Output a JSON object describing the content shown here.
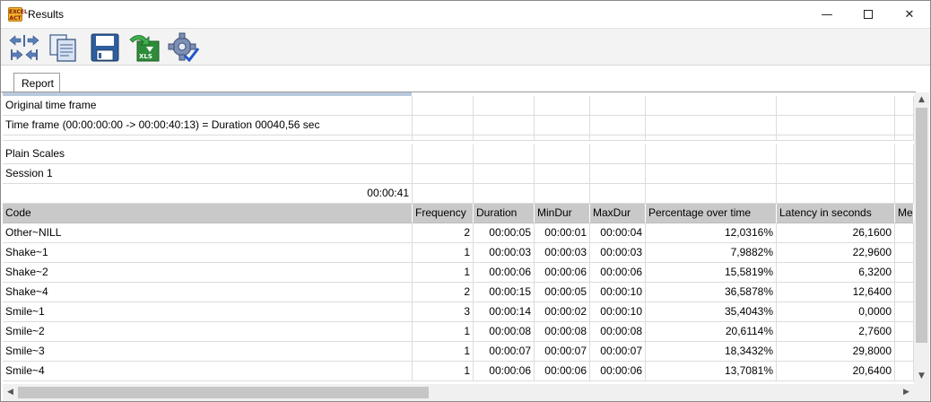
{
  "window": {
    "title": "Results",
    "app_icon_text": "EXCEL ACT",
    "controls": {
      "minimize": "—",
      "close": "✕"
    }
  },
  "toolbar": {
    "buttons": [
      {
        "icon": "arrows-expand-collapse-icon"
      },
      {
        "icon": "copy-document-icon"
      },
      {
        "icon": "save-disk-icon"
      },
      {
        "icon": "export-xls-icon",
        "label": "XLS"
      },
      {
        "icon": "settings-gear-check-icon"
      }
    ]
  },
  "tabs": [
    {
      "label": "Report"
    }
  ],
  "report": {
    "info_rows": [
      "Original time frame",
      "Time frame  (00:00:00:00 -> 00:00:40:13) = Duration 00040,56 sec",
      "",
      "Plain Scales",
      "Session 1"
    ],
    "total_time": "00:00:41",
    "columns": [
      "Code",
      "Frequency",
      "Duration",
      "MinDur",
      "MaxDur",
      "Percentage over time",
      "Latency in seconds",
      "Me"
    ],
    "rows": [
      [
        "Other~NILL",
        "2",
        "00:00:05",
        "00:00:01",
        "00:00:04",
        "12,0316%",
        "26,1600"
      ],
      [
        "Shake~1",
        "1",
        "00:00:03",
        "00:00:03",
        "00:00:03",
        "7,9882%",
        "22,9600"
      ],
      [
        "Shake~2",
        "1",
        "00:00:06",
        "00:00:06",
        "00:00:06",
        "15,5819%",
        "6,3200"
      ],
      [
        "Shake~4",
        "2",
        "00:00:15",
        "00:00:05",
        "00:00:10",
        "36,5878%",
        "12,6400"
      ],
      [
        "Smile~1",
        "3",
        "00:00:14",
        "00:00:02",
        "00:00:10",
        "35,4043%",
        "0,0000"
      ],
      [
        "Smile~2",
        "1",
        "00:00:08",
        "00:00:08",
        "00:00:08",
        "20,6114%",
        "2,7600"
      ],
      [
        "Smile~3",
        "1",
        "00:00:07",
        "00:00:07",
        "00:00:07",
        "18,3432%",
        "29,8000"
      ],
      [
        "Smile~4",
        "1",
        "00:00:06",
        "00:00:06",
        "00:00:06",
        "13,7081%",
        "20,6400"
      ]
    ]
  },
  "colors": {
    "header_bg": "#c9c9c9",
    "progress": "#b9c9dc",
    "toolbar_bg": "#f3f3f3"
  }
}
